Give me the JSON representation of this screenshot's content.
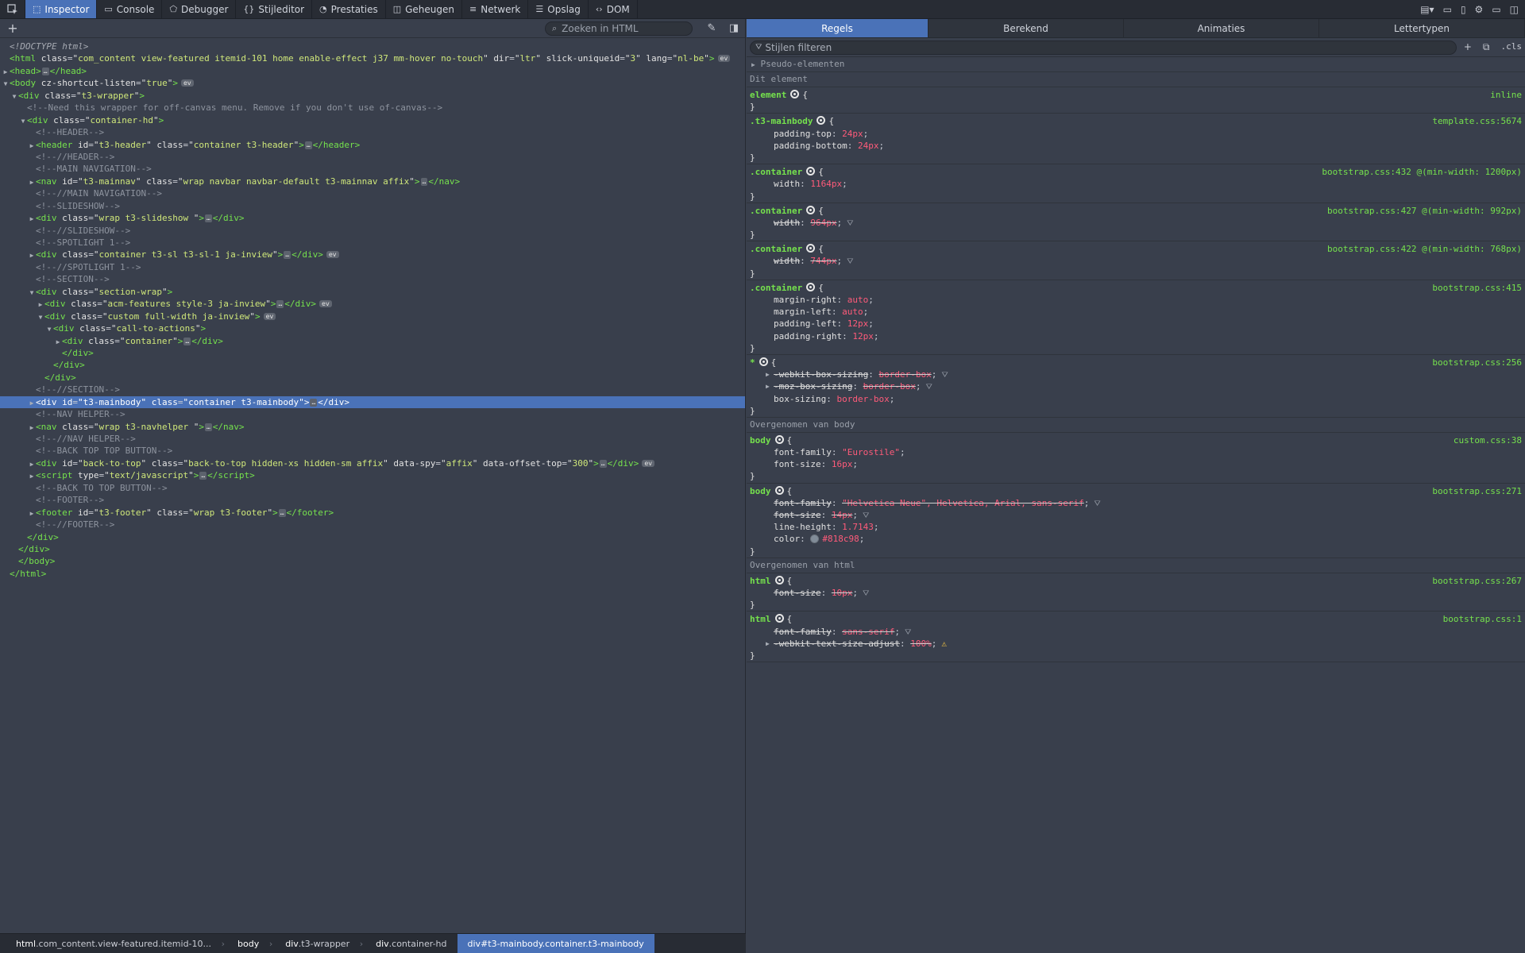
{
  "toolbar": {
    "tabs": [
      {
        "label": "Inspector",
        "icon": "inspector-icon",
        "glyph": "⬚"
      },
      {
        "label": "Console",
        "icon": "console-icon",
        "glyph": "▭"
      },
      {
        "label": "Debugger",
        "icon": "debugger-icon",
        "glyph": "⬠"
      },
      {
        "label": "Stijleditor",
        "icon": "style-editor-icon",
        "glyph": "{}"
      },
      {
        "label": "Prestaties",
        "icon": "performance-icon",
        "glyph": "◔"
      },
      {
        "label": "Geheugen",
        "icon": "memory-icon",
        "glyph": "◫"
      },
      {
        "label": "Netwerk",
        "icon": "network-icon",
        "glyph": "≡"
      },
      {
        "label": "Opslag",
        "icon": "storage-icon",
        "glyph": "☰"
      },
      {
        "label": "DOM",
        "icon": "dom-icon",
        "glyph": "‹›"
      }
    ]
  },
  "markup": {
    "search_placeholder": "Zoeken in HTML",
    "lines": [
      {
        "d": 0,
        "html": "<span class='dt'>&lt;!DOCTYPE html&gt;</span>"
      },
      {
        "d": 0,
        "html": "<span class='tag'>&lt;html</span> <span class='an'>class</span>=<span class='br'>\"</span><span class='av'>com_content view-featured itemid-101 home enable-effect j37 mm-hover no-touch</span><span class='br'>\"</span> <span class='an'>dir</span>=<span class='br'>\"</span><span class='av'>ltr</span><span class='br'>\"</span> <span class='an'>slick-uniqueid</span>=<span class='br'>\"</span><span class='av'>3</span><span class='br'>\"</span> <span class='an'>lang</span>=<span class='br'>\"</span><span class='av'>nl-be</span><span class='br'>\"</span><span class='tag'>&gt;</span><span class='ev'>ev</span>"
      },
      {
        "d": 0,
        "tw": "▶",
        "html": "<span class='tag'>&lt;head&gt;</span><span class='coll'>…</span><span class='tag'>&lt;/head&gt;</span>"
      },
      {
        "d": 0,
        "tw": "▼",
        "html": "<span class='tag'>&lt;body</span> <span class='an'>cz-shortcut-listen</span>=<span class='br'>\"</span><span class='av'>true</span><span class='br'>\"</span><span class='tag'>&gt;</span><span class='ev'>ev</span>"
      },
      {
        "d": 1,
        "tw": "▼",
        "html": "<span class='tag'>&lt;div</span> <span class='an'>class</span>=<span class='br'>\"</span><span class='av'>t3-wrapper</span><span class='br'>\"</span><span class='tag'>&gt;</span>"
      },
      {
        "d": 2,
        "html": "<span class='cm'>&lt;!--Need this wrapper for off-canvas menu. Remove if you don't use of-canvas--&gt;</span>"
      },
      {
        "d": 2,
        "tw": "▼",
        "html": "<span class='tag'>&lt;div</span> <span class='an'>class</span>=<span class='br'>\"</span><span class='av'>container-hd</span><span class='br'>\"</span><span class='tag'>&gt;</span>"
      },
      {
        "d": 3,
        "html": "<span class='cm'>&lt;!--HEADER--&gt;</span>"
      },
      {
        "d": 3,
        "tw": "▶",
        "html": "<span class='tag'>&lt;header</span> <span class='an'>id</span>=<span class='br'>\"</span><span class='av'>t3-header</span><span class='br'>\"</span> <span class='an'>class</span>=<span class='br'>\"</span><span class='av'>container t3-header</span><span class='br'>\"</span><span class='tag'>&gt;</span><span class='coll'>…</span><span class='tag'>&lt;/header&gt;</span>"
      },
      {
        "d": 3,
        "html": "<span class='cm'>&lt;!--//HEADER--&gt;</span>"
      },
      {
        "d": 3,
        "html": "<span class='cm'>&lt;!--MAIN NAVIGATION--&gt;</span>"
      },
      {
        "d": 3,
        "tw": "▶",
        "html": "<span class='tag'>&lt;nav</span> <span class='an'>id</span>=<span class='br'>\"</span><span class='av'>t3-mainnav</span><span class='br'>\"</span> <span class='an'>class</span>=<span class='br'>\"</span><span class='av'>wrap navbar navbar-default t3-mainnav affix</span><span class='br'>\"</span><span class='tag'>&gt;</span><span class='coll'>…</span><span class='tag'>&lt;/nav&gt;</span>"
      },
      {
        "d": 3,
        "html": "<span class='cm'>&lt;!--//MAIN NAVIGATION--&gt;</span>"
      },
      {
        "d": 3,
        "html": "<span class='cm'>&lt;!--SLIDESHOW--&gt;</span>"
      },
      {
        "d": 3,
        "tw": "▶",
        "html": "<span class='tag'>&lt;div</span> <span class='an'>class</span>=<span class='br'>\"</span><span class='av'>wrap t3-slideshow </span><span class='br'>\"</span><span class='tag'>&gt;</span><span class='coll'>…</span><span class='tag'>&lt;/div&gt;</span>"
      },
      {
        "d": 3,
        "html": "<span class='cm'>&lt;!--//SLIDESHOW--&gt;</span>"
      },
      {
        "d": 3,
        "html": "<span class='cm'>&lt;!--SPOTLIGHT 1--&gt;</span>"
      },
      {
        "d": 3,
        "tw": "▶",
        "html": "<span class='tag'>&lt;div</span> <span class='an'>class</span>=<span class='br'>\"</span><span class='av'>container t3-sl t3-sl-1 ja-inview</span><span class='br'>\"</span><span class='tag'>&gt;</span><span class='coll'>…</span><span class='tag'>&lt;/div&gt;</span><span class='ev'>ev</span>"
      },
      {
        "d": 3,
        "html": "<span class='cm'>&lt;!--//SPOTLIGHT 1--&gt;</span>"
      },
      {
        "d": 3,
        "html": "<span class='cm'>&lt;!--SECTION--&gt;</span>"
      },
      {
        "d": 3,
        "tw": "▼",
        "html": "<span class='tag'>&lt;div</span> <span class='an'>class</span>=<span class='br'>\"</span><span class='av'>section-wrap</span><span class='br'>\"</span><span class='tag'>&gt;</span>"
      },
      {
        "d": 4,
        "tw": "▶",
        "html": "<span class='tag'>&lt;div</span> <span class='an'>class</span>=<span class='br'>\"</span><span class='av'>acm-features style-3 ja-inview</span><span class='br'>\"</span><span class='tag'>&gt;</span><span class='coll'>…</span><span class='tag'>&lt;/div&gt;</span><span class='ev'>ev</span>"
      },
      {
        "d": 4,
        "tw": "▼",
        "html": "<span class='tag'>&lt;div</span> <span class='an'>class</span>=<span class='br'>\"</span><span class='av'>custom full-width ja-inview</span><span class='br'>\"</span><span class='tag'>&gt;</span><span class='ev'>ev</span>"
      },
      {
        "d": 5,
        "tw": "▼",
        "html": "<span class='tag'>&lt;div</span> <span class='an'>class</span>=<span class='br'>\"</span><span class='av'>call-to-actions</span><span class='br'>\"</span><span class='tag'>&gt;</span>"
      },
      {
        "d": 6,
        "tw": "▶",
        "html": "<span class='tag'>&lt;div</span> <span class='an'>class</span>=<span class='br'>\"</span><span class='av'>container</span><span class='br'>\"</span><span class='tag'>&gt;</span><span class='coll'>…</span><span class='tag'>&lt;/div&gt;</span>"
      },
      {
        "d": 6,
        "html": "<span class='tag'>&lt;/div&gt;</span>"
      },
      {
        "d": 5,
        "html": "<span class='tag'>&lt;/div&gt;</span>"
      },
      {
        "d": 4,
        "html": "<span class='tag'>&lt;/div&gt;</span>"
      },
      {
        "d": 3,
        "html": "<span class='cm'>&lt;!--//SECTION--&gt;</span>"
      },
      {
        "d": 3,
        "tw": "▶",
        "sel": true,
        "html": "<span class='tag'>&lt;div</span> <span class='an'>id</span>=<span class='br'>\"</span><span class='av'>t3-mainbody</span><span class='br'>\"</span> <span class='an'>class</span>=<span class='br'>\"</span><span class='av'>container t3-mainbody</span><span class='br'>\"</span><span class='tag'>&gt;</span><span class='coll'>…</span><span class='tag'>&lt;/div&gt;</span>"
      },
      {
        "d": 3,
        "html": "<span class='cm'>&lt;!--NAV HELPER--&gt;</span>"
      },
      {
        "d": 3,
        "tw": "▶",
        "html": "<span class='tag'>&lt;nav</span> <span class='an'>class</span>=<span class='br'>\"</span><span class='av'>wrap t3-navhelper </span><span class='br'>\"</span><span class='tag'>&gt;</span><span class='coll'>…</span><span class='tag'>&lt;/nav&gt;</span>"
      },
      {
        "d": 3,
        "html": "<span class='cm'>&lt;!--//NAV HELPER--&gt;</span>"
      },
      {
        "d": 3,
        "html": "<span class='cm'>&lt;!--BACK TOP TOP BUTTON--&gt;</span>"
      },
      {
        "d": 3,
        "tw": "▶",
        "html": "<span class='tag'>&lt;div</span> <span class='an'>id</span>=<span class='br'>\"</span><span class='av'>back-to-top</span><span class='br'>\"</span> <span class='an'>class</span>=<span class='br'>\"</span><span class='av'>back-to-top hidden-xs hidden-sm affix</span><span class='br'>\"</span> <span class='an'>data-spy</span>=<span class='br'>\"</span><span class='av'>affix</span><span class='br'>\"</span> <span class='an'>data-offset-top</span>=<span class='br'>\"</span><span class='av'>300</span><span class='br'>\"</span><span class='tag'>&gt;</span><span class='coll'>…</span><span class='tag'>&lt;/div&gt;</span><span class='ev'>ev</span>"
      },
      {
        "d": 3,
        "tw": "▶",
        "html": "<span class='tag'>&lt;script</span> <span class='an'>type</span>=<span class='br'>\"</span><span class='av'>text/javascript</span><span class='br'>\"</span><span class='tag'>&gt;</span><span class='coll'>…</span><span class='tag'>&lt;/script&gt;</span>"
      },
      {
        "d": 3,
        "html": "<span class='cm'>&lt;!--BACK TO TOP BUTTON--&gt;</span>"
      },
      {
        "d": 3,
        "html": "<span class='cm'>&lt;!--FOOTER--&gt;</span>"
      },
      {
        "d": 3,
        "tw": "▶",
        "html": "<span class='tag'>&lt;footer</span> <span class='an'>id</span>=<span class='br'>\"</span><span class='av'>t3-footer</span><span class='br'>\"</span> <span class='an'>class</span>=<span class='br'>\"</span><span class='av'>wrap t3-footer</span><span class='br'>\"</span><span class='tag'>&gt;</span><span class='coll'>…</span><span class='tag'>&lt;/footer&gt;</span>"
      },
      {
        "d": 3,
        "html": "<span class='cm'>&lt;!--//FOOTER--&gt;</span>"
      },
      {
        "d": 2,
        "html": "<span class='tag'>&lt;/div&gt;</span>"
      },
      {
        "d": 1,
        "html": "<span class='tag'>&lt;/div&gt;</span>"
      },
      {
        "d": 1,
        "html": "<span class='tag'>&lt;/body&gt;</span>"
      },
      {
        "d": 0,
        "html": "<span class='tag'>&lt;/html&gt;</span>"
      }
    ]
  },
  "breadcrumbs": [
    {
      "tag": "html",
      "rest": ".com_content.view-featured.itemid-10..."
    },
    {
      "tag": "body",
      "rest": ""
    },
    {
      "tag": "div",
      "rest": ".t3-wrapper"
    },
    {
      "tag": "div",
      "rest": ".container-hd"
    },
    {
      "tag": "div",
      "rest": "#t3-mainbody.container.t3-mainbody",
      "active": true
    }
  ],
  "rules_panel": {
    "tabs": [
      {
        "label": "Regels",
        "active": true
      },
      {
        "label": "Berekend"
      },
      {
        "label": "Animaties"
      },
      {
        "label": "Lettertypen"
      }
    ],
    "filter_placeholder": "Stijlen filteren",
    "class_toggle": ".cls",
    "pseudo_label": "Pseudo-elementen",
    "sections": [
      {
        "header": "Dit element",
        "rules": [
          {
            "selector": "element",
            "source": "inline",
            "decls": []
          },
          {
            "selector": ".t3-mainbody",
            "source": "template.css:5674",
            "decls": [
              {
                "p": "padding-top",
                "v": "24px"
              },
              {
                "p": "padding-bottom",
                "v": "24px"
              }
            ]
          },
          {
            "selector": ".container",
            "source": "bootstrap.css:432 @(min-width: 1200px)",
            "decls": [
              {
                "p": "width",
                "v": "1164px"
              }
            ]
          },
          {
            "selector": ".container",
            "source": "bootstrap.css:427 @(min-width: 992px)",
            "decls": [
              {
                "p": "width",
                "v": "964px",
                "struck": true,
                "filter": true
              }
            ]
          },
          {
            "selector": ".container",
            "source": "bootstrap.css:422 @(min-width: 768px)",
            "decls": [
              {
                "p": "width",
                "v": "744px",
                "struck": true,
                "filter": true
              }
            ]
          },
          {
            "selector": ".container",
            "source": "bootstrap.css:415",
            "decls": [
              {
                "p": "margin-right",
                "v": "auto"
              },
              {
                "p": "margin-left",
                "v": "auto"
              },
              {
                "p": "padding-left",
                "v": "12px"
              },
              {
                "p": "padding-right",
                "v": "12px"
              }
            ]
          },
          {
            "selector": "*",
            "source": "bootstrap.css:256",
            "decls": [
              {
                "p": "-webkit-box-sizing",
                "v": "border-box",
                "struck": true,
                "filter": true,
                "expand": true
              },
              {
                "p": "-moz-box-sizing",
                "v": "border-box",
                "struck": true,
                "filter": true,
                "expand": true
              },
              {
                "p": "box-sizing",
                "v": "border-box"
              }
            ]
          }
        ]
      },
      {
        "header": "Overgenomen van body",
        "rules": [
          {
            "selector": "body",
            "source": "custom.css:38",
            "decls": [
              {
                "p": "font-family",
                "v": "\"Eurostile\""
              },
              {
                "p": "font-size",
                "v": "16px"
              }
            ]
          },
          {
            "selector": "body",
            "source": "bootstrap.css:271",
            "decls": [
              {
                "p": "font-family",
                "v": "\"Helvetica Neue\", Helvetica, Arial, sans-serif",
                "struck": true,
                "filter": true
              },
              {
                "p": "font-size",
                "v": "14px",
                "struck": true,
                "filter": true
              },
              {
                "p": "line-height",
                "v": "1.7143"
              },
              {
                "p": "color",
                "v": "#818c98",
                "swatch": true
              }
            ]
          }
        ]
      },
      {
        "header": "Overgenomen van html",
        "rules": [
          {
            "selector": "html",
            "source": "bootstrap.css:267",
            "decls": [
              {
                "p": "font-size",
                "v": "10px",
                "struck": true,
                "filter": true
              }
            ]
          },
          {
            "selector": "html",
            "source": "bootstrap.css:1",
            "decls": [
              {
                "p": "font-family",
                "v": "sans-serif",
                "struck": true,
                "filter": true
              },
              {
                "p": "-webkit-text-size-adjust",
                "v": "100%",
                "struck": true,
                "warn": true,
                "expand": true
              }
            ]
          }
        ]
      }
    ]
  },
  "colors": {
    "accent": "#4a72b8",
    "panel_bg": "#393f4c",
    "toolbar_bg": "#282c34",
    "tag": "#75e14d",
    "attr_value": "#cfe77a",
    "prop_value": "#ff5b7a",
    "comment": "#8d939e"
  }
}
